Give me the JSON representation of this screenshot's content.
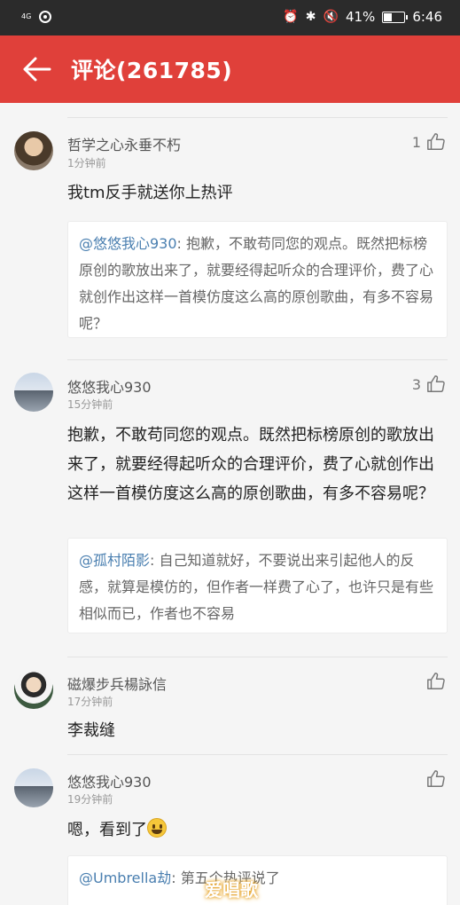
{
  "status_bar": {
    "signal": "4G",
    "battery_percent": "41%",
    "battery_level": 0.41,
    "time": "6:46"
  },
  "header": {
    "title": "评论(261785)"
  },
  "comments": [
    {
      "username": "哲学之心永垂不朽",
      "time": "1分钟前",
      "likes": "1",
      "text": "我tm反手就送你上热评",
      "quote_mention": "@悠悠我心930",
      "quote_text": ": 抱歉，不敢苟同您的观点。既然把标榜原创的歌放出来了，就要经得起听众的合理评价，费了心就创作出这样一首模仿度这么高的原创歌曲，有多不容易呢？"
    },
    {
      "username": "悠悠我心930",
      "time": "15分钟前",
      "likes": "3",
      "text": "抱歉，不敢苟同您的观点。既然把标榜原创的歌放出来了，就要经得起听众的合理评价，费了心就创作出这样一首模仿度这么高的原创歌曲，有多不容易呢？",
      "quote_mention": "@孤村陌影",
      "quote_text": ": 自己知道就好，不要说出来引起他人的反感，就算是模仿的，但作者一样费了心了，也许只是有些相似而已，作者也不容易"
    },
    {
      "username": "磁爆步兵楊詠信",
      "time": "17分钟前",
      "likes": "",
      "text": "李裁缝"
    },
    {
      "username": "悠悠我心930",
      "time": "19分钟前",
      "likes": "",
      "text": "嗯，看到了",
      "quote_mention": "@Umbrella劫",
      "quote_text": ": 第五个热评说了"
    }
  ],
  "watermark": "爱唱歌",
  "colors": {
    "accent": "#e0403a",
    "mention": "#4a7fb0"
  }
}
